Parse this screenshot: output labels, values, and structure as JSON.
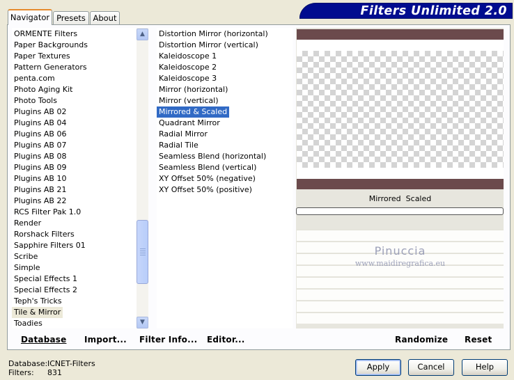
{
  "tabs": [
    "Navigator",
    "Presets",
    "About"
  ],
  "banner_title": "Filters Unlimited 2.0",
  "categories": [
    "ORMENTE Filters",
    "Paper Backgrounds",
    "Paper Textures",
    "Pattern Generators",
    "penta.com",
    "Photo Aging Kit",
    "Photo Tools",
    "Plugins AB 02",
    "Plugins AB 04",
    "Plugins AB 06",
    "Plugins AB 07",
    "Plugins AB 08",
    "Plugins AB 09",
    "Plugins AB 10",
    "Plugins AB 21",
    "Plugins AB 22",
    "RCS Filter Pak 1.0",
    "Render",
    "Rorshack Filters",
    "Sapphire Filters 01",
    "Scribe",
    "Simple",
    "Special Effects 1",
    "Special Effects 2",
    "Teph's Tricks",
    "Tile & Mirror",
    "Toadies"
  ],
  "selected_category": "Tile & Mirror",
  "filters": [
    "Distortion Mirror (horizontal)",
    "Distortion Mirror (vertical)",
    "Kaleidoscope 1",
    "Kaleidoscope 2",
    "Kaleidoscope 3",
    "Mirror (horizontal)",
    "Mirror (vertical)",
    "Mirrored & Scaled",
    "Quadrant Mirror",
    "Radial Mirror",
    "Radial Tile",
    "Seamless Blend (horizontal)",
    "Seamless Blend (vertical)",
    "XY Offset 50% (negative)",
    "XY Offset 50% (positive)"
  ],
  "selected_filter": "Mirrored & Scaled",
  "preview": {
    "filter_name": "Mirrored  Scaled",
    "watermark_name": "Pinuccia",
    "watermark_url": "www.maidiregrafica.eu"
  },
  "footer_links": {
    "database": "Database",
    "import": "Import...",
    "filter_info": "Filter Info...",
    "editor": "Editor...",
    "randomize": "Randomize",
    "reset": "Reset"
  },
  "status": {
    "database_label": "Database:",
    "database_value": "ICNET-Filters",
    "filters_label": "Filters:",
    "filters_value": "831"
  },
  "buttons": {
    "apply": "Apply",
    "cancel": "Cancel",
    "help": "Help"
  },
  "colors": {
    "banner": "#000c8f",
    "selection": "#316ac5",
    "preview_bar": "#6b4a4c"
  }
}
